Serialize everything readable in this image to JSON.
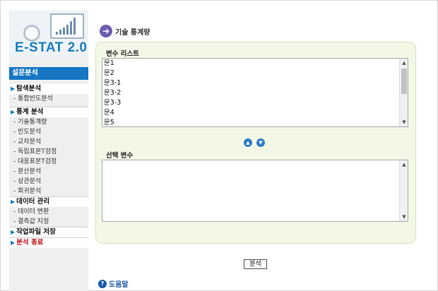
{
  "logo": {
    "text": "E-STAT 2.0"
  },
  "sidebar": {
    "section_title": "설문분석",
    "groups": [
      {
        "label": "탐색분석",
        "items": [
          "통합빈도분석"
        ]
      },
      {
        "label": "통계 분석",
        "items": [
          "기술통계량",
          "빈도분석",
          "교차분석",
          "독립표본T검정",
          "대응표본T검정",
          "분산분석",
          "상관분석",
          "회귀분석"
        ]
      },
      {
        "label": "데이터 관리",
        "items": [
          "데이터 변환",
          "결측값 지정"
        ]
      },
      {
        "label": "작업파일 저장",
        "items": []
      },
      {
        "label": "분석 종료",
        "items": []
      }
    ]
  },
  "main": {
    "title": "기술 통계량",
    "variable_list_label": "변수 리스트",
    "variables": [
      "문1",
      "문2",
      "문3-1",
      "문3-2",
      "문3-3",
      "문4",
      "문5"
    ],
    "selected_label": "선택 변수",
    "analyze_button": "분석",
    "help_label": "도움말"
  },
  "colors": {
    "accent": "#1676c4",
    "panel": "#f3f8e6",
    "exit_red": "#c0181f"
  }
}
